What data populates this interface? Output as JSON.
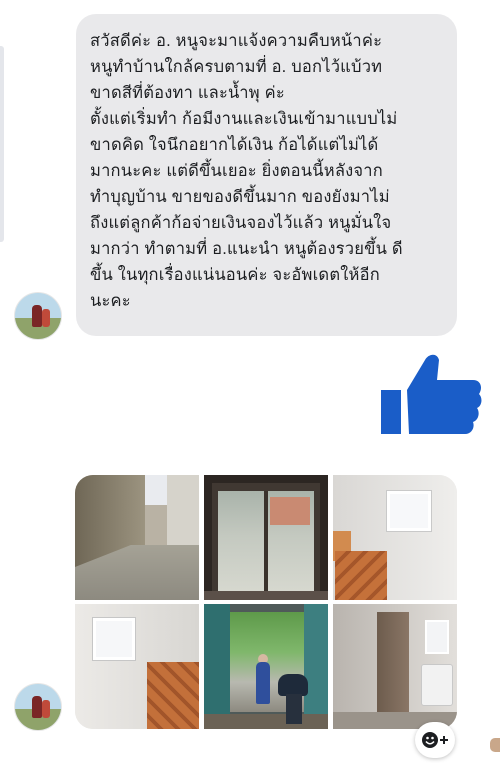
{
  "conversation": {
    "message_text": "สวัสดีค่ะ อ. หนูจะมาแจ้งความคืบหน้าค่ะ\nหนูทำบ้านใกล้ครบตามที่ อ. บอกไว้แบ้วท\nขาดสีที่ต้องทา และน้ำพุ ค่ะ\nตั้งแต่เริ่มทำ ก้อมีงานและเงินเข้ามาแบบไม่\nขาดคิด ใจนึกอยากได้เงิน ก้อได้แต่ไม่ได้\nมากนะคะ แต่ดีขึ้นเยอะ ยิ่งตอนนี้หลังจาก\nทำบุญบ้าน ขายของดีขึ้นมาก ของยังมาไม่\nถึงแต่ลูกค้าก้อจ่ายเงินจองไว้แล้ว หนูมั่นใจ\nมากว่า ทำตามที่ อ.แนะนำ หนูต้องรวยขึ้น ดี\nขึ้น ในทุกเรื่องแน่นอนค่ะ จะอัพเดตให้อีก\nนะคะ",
    "thumbs_up_color": "#1a5dc8",
    "bubble_color": "#e9e9eb",
    "photos": [
      {
        "icon": "alley-photo"
      },
      {
        "icon": "sliding-door-photo"
      },
      {
        "icon": "room-window-photo"
      },
      {
        "icon": "room-window-photo"
      },
      {
        "icon": "doorway-people-photo"
      },
      {
        "icon": "room-appliance-photo"
      }
    ],
    "reaction_button": {
      "icon": "smiley-plus-icon"
    }
  }
}
